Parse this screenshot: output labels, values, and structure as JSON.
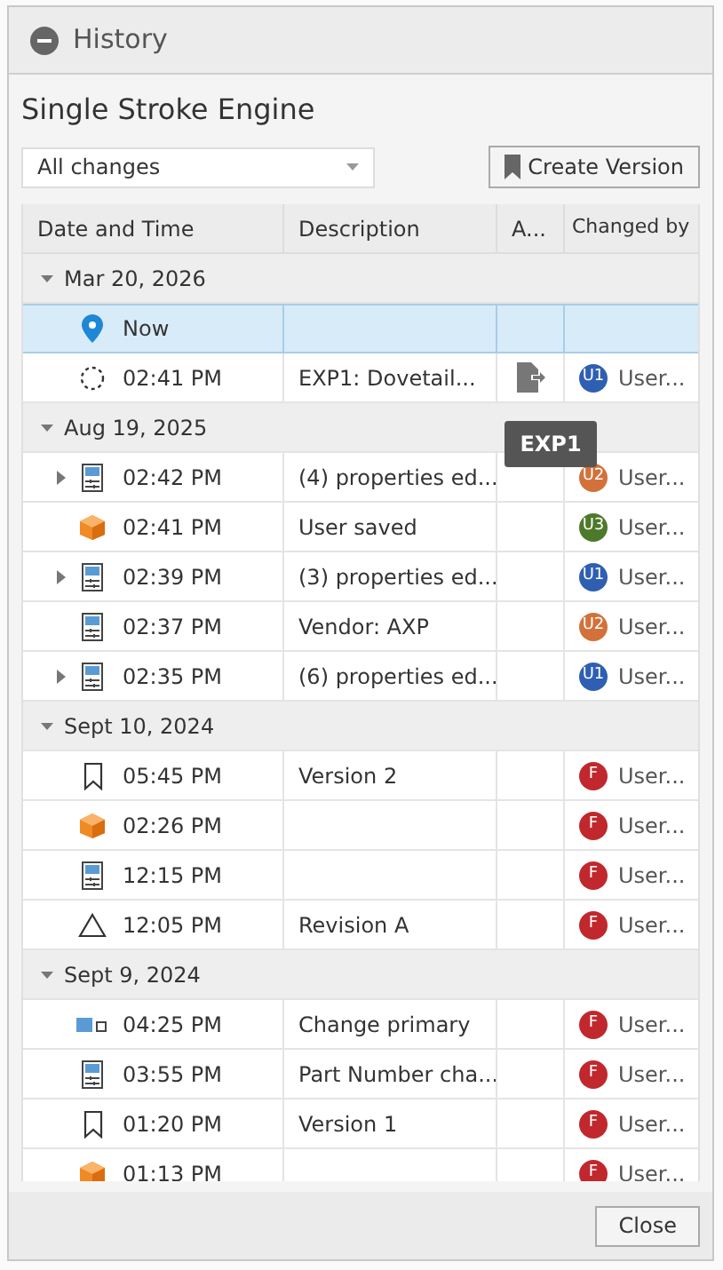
{
  "window": {
    "title": "History"
  },
  "heading": "Single Stroke Engine",
  "filter": {
    "value": "All changes"
  },
  "create_button": "Create Version",
  "table": {
    "columns": [
      "Date and Time",
      "Description",
      "A...",
      "Changed by"
    ],
    "groups": [
      {
        "label": "Mar 20, 2026",
        "expanded": true,
        "rows": [
          {
            "kind": "now",
            "time": "Now",
            "attachment": false,
            "expandable": false,
            "selected": true
          },
          {
            "kind": "draft",
            "time": "02:41 PM",
            "description": "EXP1: Dovetail...",
            "attachment": true,
            "user": "U1",
            "user_name": "User...",
            "color": "#2f5fb3",
            "expandable": false,
            "selected": false
          }
        ]
      },
      {
        "label": "Aug 19, 2025",
        "expanded": true,
        "rows": [
          {
            "kind": "properties",
            "time": "02:42 PM",
            "description": "(4) properties ed...",
            "attachment": false,
            "user": "U2",
            "user_name": "User...",
            "color": "#d2713a",
            "expandable": true,
            "selected": false
          },
          {
            "kind": "part",
            "time": "02:41 PM",
            "description": "User saved",
            "attachment": false,
            "user": "U3",
            "user_name": "User...",
            "color": "#4d7a2a",
            "expandable": false,
            "selected": false
          },
          {
            "kind": "properties",
            "time": "02:39 PM",
            "description": "(3) properties ed...",
            "attachment": false,
            "user": "U1",
            "user_name": "User...",
            "color": "#2f5fb3",
            "expandable": true,
            "selected": false
          },
          {
            "kind": "properties",
            "time": "02:37 PM",
            "description": "Vendor: AXP",
            "attachment": false,
            "user": "U2",
            "user_name": "User...",
            "color": "#d2713a",
            "expandable": false,
            "selected": false
          },
          {
            "kind": "properties",
            "time": "02:35 PM",
            "description": "(6) properties ed...",
            "attachment": false,
            "user": "U1",
            "user_name": "User...",
            "color": "#2f5fb3",
            "expandable": true,
            "selected": false
          }
        ]
      },
      {
        "label": "Sept 10, 2024",
        "expanded": true,
        "rows": [
          {
            "kind": "version",
            "time": "05:45 PM",
            "description": "Version 2",
            "attachment": false,
            "user": "F",
            "user_name": "User...",
            "color": "#c0282d",
            "expandable": false,
            "selected": false
          },
          {
            "kind": "part",
            "time": "02:26 PM",
            "attachment": false,
            "user": "F",
            "user_name": "User...",
            "color": "#c0282d",
            "expandable": false,
            "selected": false
          },
          {
            "kind": "properties",
            "time": "12:15 PM",
            "attachment": false,
            "user": "F",
            "user_name": "User...",
            "color": "#c0282d",
            "expandable": false,
            "selected": false
          },
          {
            "kind": "revision",
            "time": "12:05 PM",
            "description": "Revision A",
            "attachment": false,
            "user": "F",
            "user_name": "User...",
            "color": "#c0282d",
            "expandable": false,
            "selected": false
          }
        ]
      },
      {
        "label": "Sept 9, 2024",
        "expanded": true,
        "rows": [
          {
            "kind": "primary",
            "time": "04:25 PM",
            "description": "Change primary",
            "attachment": false,
            "user": "F",
            "user_name": "User...",
            "color": "#c0282d",
            "expandable": false,
            "selected": false
          },
          {
            "kind": "properties",
            "time": "03:55 PM",
            "description": "Part Number cha...",
            "attachment": false,
            "user": "F",
            "user_name": "User...",
            "color": "#c0282d",
            "expandable": false,
            "selected": false
          },
          {
            "kind": "version",
            "time": "01:20 PM",
            "description": "Version 1",
            "attachment": false,
            "user": "F",
            "user_name": "User...",
            "color": "#c0282d",
            "expandable": false,
            "selected": false
          },
          {
            "kind": "part",
            "time": "01:13 PM",
            "attachment": false,
            "user": "F",
            "user_name": "User...",
            "color": "#c0282d",
            "expandable": false,
            "selected": false
          }
        ]
      }
    ]
  },
  "tooltip": {
    "text": "EXP1"
  },
  "close_button": "Close"
}
